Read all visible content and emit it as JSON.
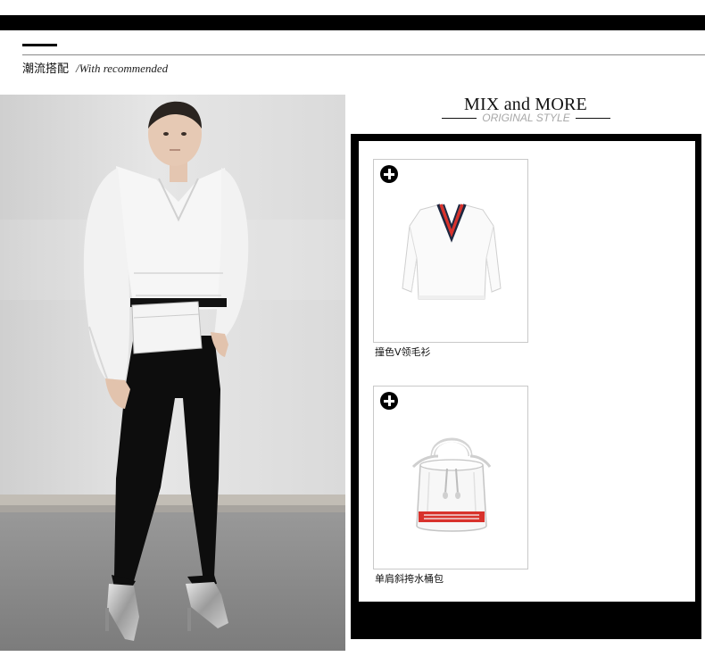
{
  "header": {
    "title_cn": "潮流搭配",
    "title_en": "/With recommended"
  },
  "mix": {
    "title": "MIX and MORE",
    "subtitle": "ORIGINAL STYLE"
  },
  "products": [
    {
      "name": "撞色V领毛衫",
      "icon": "plus-circle-icon",
      "image": "white-knit-v-neck-sweater-with-red-navy-trim"
    },
    {
      "name": "单肩斜挎水桶包",
      "icon": "plus-circle-icon",
      "image": "white-bucket-bag-with-red-speed-print"
    }
  ],
  "photo": {
    "subject": "model wearing white sweater, black stirrup leggings, silver heels and white belt bag"
  },
  "colors": {
    "bar": "#000000",
    "subtitle_gray": "#a7a7a7",
    "accent_red": "#d8322c",
    "accent_navy": "#1d2740"
  }
}
